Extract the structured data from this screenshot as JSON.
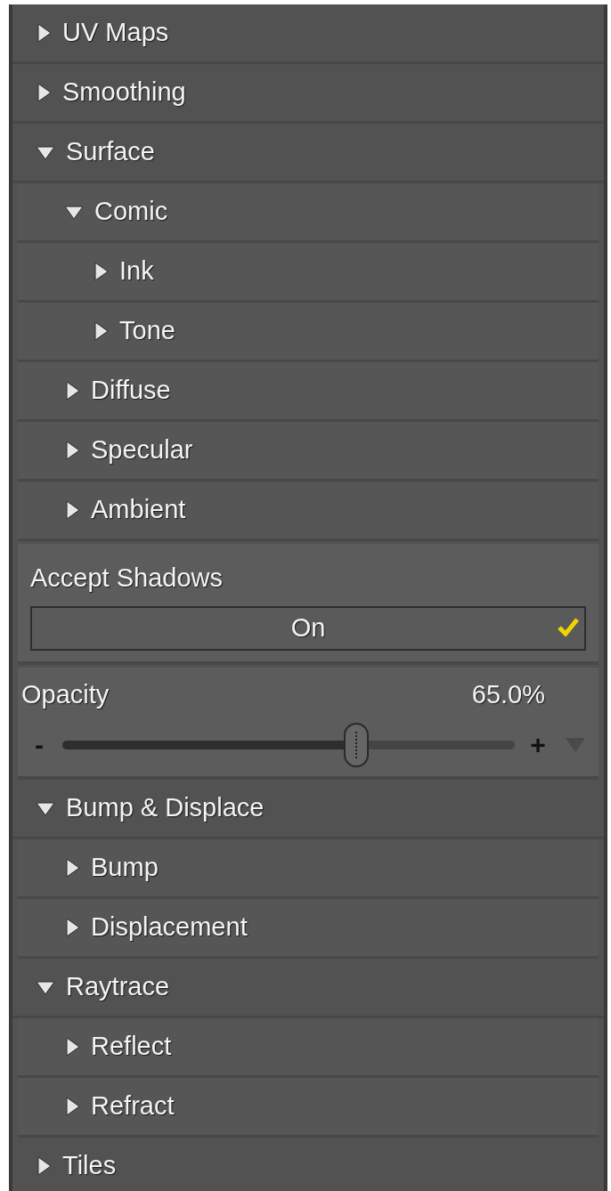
{
  "items": [
    {
      "kind": "group",
      "label": "UV Maps",
      "expanded": false
    },
    {
      "kind": "group",
      "label": "Smoothing",
      "expanded": false
    },
    {
      "kind": "group",
      "label": "Surface",
      "expanded": true,
      "children": [
        {
          "kind": "group",
          "label": "Comic",
          "expanded": true,
          "children": [
            {
              "kind": "group",
              "label": "Ink",
              "expanded": false
            },
            {
              "kind": "group",
              "label": "Tone",
              "expanded": false
            }
          ]
        },
        {
          "kind": "group",
          "label": "Diffuse",
          "expanded": false
        },
        {
          "kind": "group",
          "label": "Specular",
          "expanded": false
        },
        {
          "kind": "group",
          "label": "Ambient",
          "expanded": false
        }
      ]
    },
    {
      "kind": "toggle",
      "label": "Accept Shadows",
      "value": "On",
      "checked": true
    },
    {
      "kind": "slider",
      "label": "Opacity",
      "reading": "65.0%",
      "level": 0.65,
      "minus": "-",
      "plus": "+"
    },
    {
      "kind": "group",
      "label": "Bump & Displace",
      "expanded": true,
      "children": [
        {
          "kind": "group",
          "label": "Bump",
          "expanded": false
        },
        {
          "kind": "group",
          "label": "Displacement",
          "expanded": false
        }
      ]
    },
    {
      "kind": "group",
      "label": "Raytrace",
      "expanded": true,
      "children": [
        {
          "kind": "group",
          "label": "Reflect",
          "expanded": false
        },
        {
          "kind": "group",
          "label": "Refract",
          "expanded": false
        }
      ]
    },
    {
      "kind": "group",
      "label": "Tiles",
      "expanded": false
    }
  ]
}
